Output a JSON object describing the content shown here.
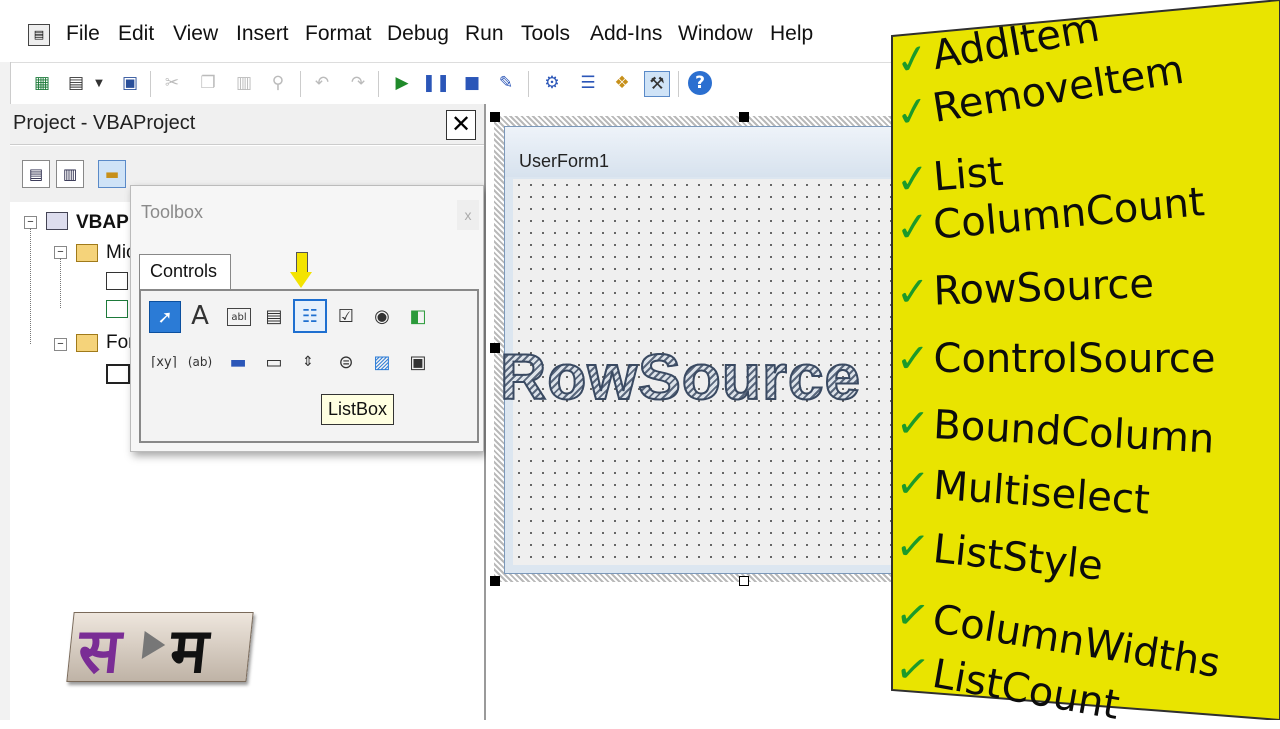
{
  "menu": {
    "items": [
      "File",
      "Edit",
      "View",
      "Insert",
      "Format",
      "Debug",
      "Run",
      "Tools",
      "Add-Ins",
      "Window",
      "Help"
    ],
    "underline": [
      "F",
      "E",
      "V",
      "I",
      "o",
      "D",
      "R",
      "T",
      "A",
      "W",
      "H"
    ]
  },
  "toolbar": {
    "icons": [
      "excel-icon",
      "insert-userform-icon",
      "dropdown-arrow-icon",
      "save-icon",
      "cut-icon",
      "copy-icon",
      "paste-icon",
      "find-icon",
      "undo-icon",
      "redo-icon",
      "run-icon",
      "break-icon",
      "reset-icon",
      "design-mode-icon",
      "project-explorer-icon",
      "properties-window-icon",
      "object-browser-icon",
      "toolbox-icon",
      "help-icon"
    ]
  },
  "project": {
    "title": "Project - VBAProject",
    "close": "✕",
    "tree": [
      {
        "label": "VBAPr",
        "level": 0,
        "bold": true
      },
      {
        "label": "Mic",
        "level": 1
      },
      {
        "label": "",
        "level": 2
      },
      {
        "label": "",
        "level": 2
      },
      {
        "label": "For",
        "level": 1
      },
      {
        "label": "",
        "level": 2
      }
    ]
  },
  "toolbox": {
    "title": "Toolbox",
    "close": "x",
    "tab": "Controls",
    "tools_row1": [
      "select-objects",
      "label",
      "textbox",
      "combobox",
      "listbox",
      "checkbox",
      "optionbutton",
      "togglebutton"
    ],
    "tools_row2": [
      "frame",
      "commandbutton",
      "tabstrip",
      "multipage",
      "scrollbar",
      "spinbutton",
      "image",
      "refedit"
    ],
    "tooltip": "ListBox"
  },
  "designer": {
    "form_caption": "UserForm1",
    "overlay_text": "RowSource"
  },
  "logo": {
    "left": "स",
    "right": "म"
  },
  "topics": {
    "items": [
      "AddItem",
      "RemoveItem",
      "List",
      "ColumnCount",
      "RowSource",
      "ControlSource",
      "BoundColumn",
      "Multiselect",
      "ListStyle",
      "ColumnWidths",
      "ListCount"
    ],
    "check": "✓",
    "colors": {
      "panel": "#e9e400",
      "check": "#1b9a2a",
      "text": "#0c0c0c"
    }
  }
}
